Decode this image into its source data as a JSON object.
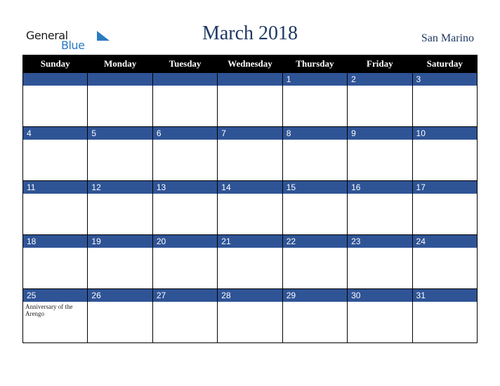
{
  "logo": {
    "line1": "General",
    "line2": "Blue"
  },
  "header": {
    "title": "March 2018",
    "country": "San Marino"
  },
  "weekdays": [
    "Sunday",
    "Monday",
    "Tuesday",
    "Wednesday",
    "Thursday",
    "Friday",
    "Saturday"
  ],
  "weeks": [
    {
      "days": [
        "",
        "",
        "",
        "",
        "1",
        "2",
        "3"
      ],
      "events": [
        "",
        "",
        "",
        "",
        "",
        "",
        ""
      ]
    },
    {
      "days": [
        "4",
        "5",
        "6",
        "7",
        "8",
        "9",
        "10"
      ],
      "events": [
        "",
        "",
        "",
        "",
        "",
        "",
        ""
      ]
    },
    {
      "days": [
        "11",
        "12",
        "13",
        "14",
        "15",
        "16",
        "17"
      ],
      "events": [
        "",
        "",
        "",
        "",
        "",
        "",
        ""
      ]
    },
    {
      "days": [
        "18",
        "19",
        "20",
        "21",
        "22",
        "23",
        "24"
      ],
      "events": [
        "",
        "",
        "",
        "",
        "",
        "",
        ""
      ]
    },
    {
      "days": [
        "25",
        "26",
        "27",
        "28",
        "29",
        "30",
        "31"
      ],
      "events": [
        "Anniversary of the Arengo",
        "",
        "",
        "",
        "",
        "",
        ""
      ]
    }
  ],
  "colors": {
    "header_bg": "#000000",
    "day_bar": "#2f5496",
    "title": "#1f3864",
    "logo_blue": "#2b7bc0"
  }
}
